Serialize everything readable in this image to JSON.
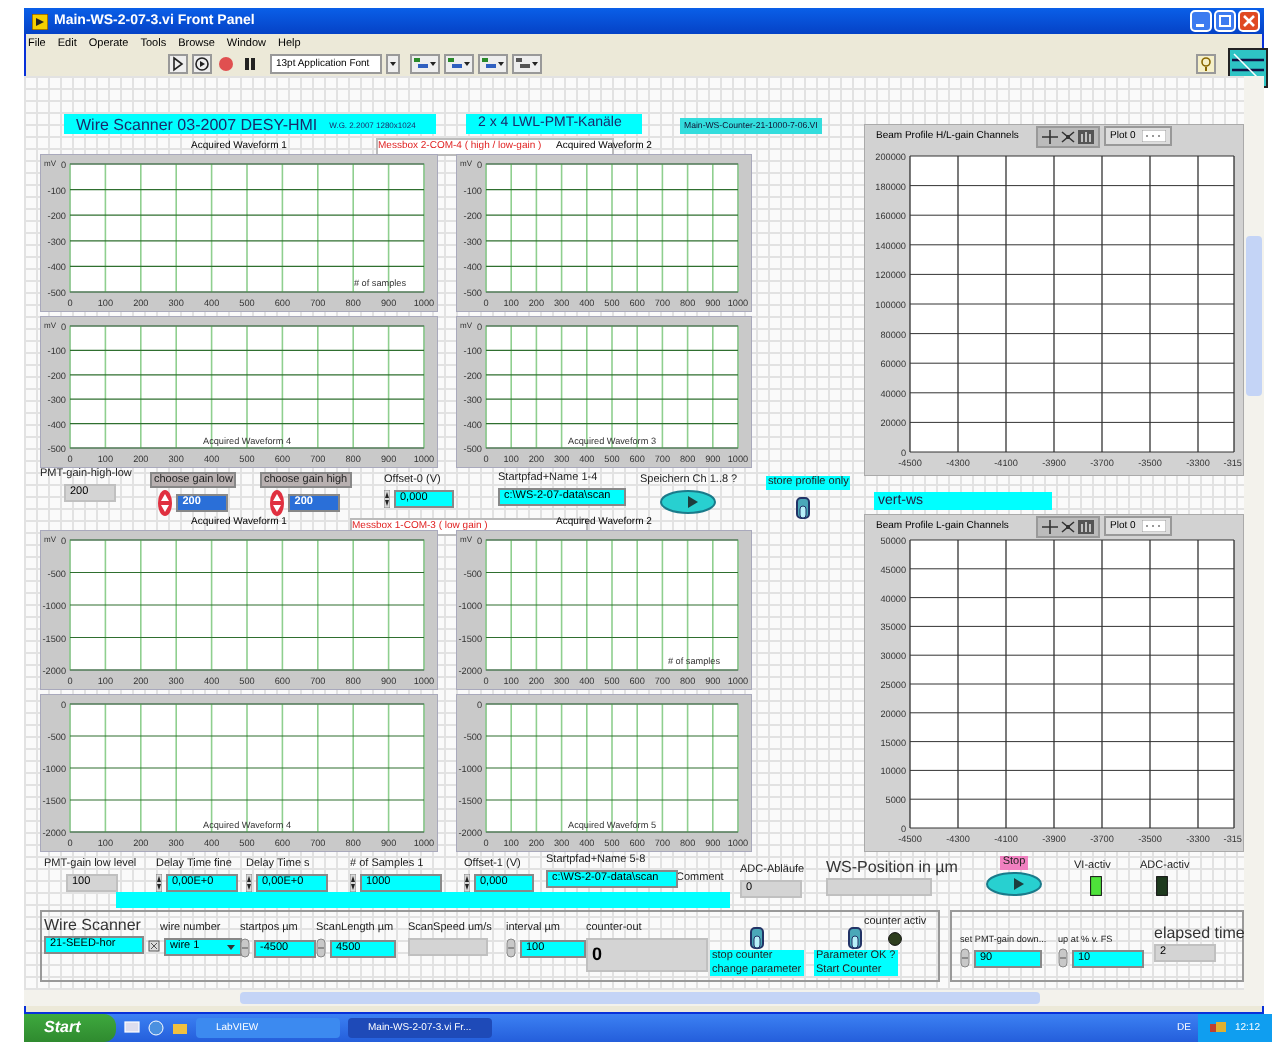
{
  "window": {
    "title": "Main-WS-2-07-3.vi Front Panel"
  },
  "menu": [
    "File",
    "Edit",
    "Operate",
    "Tools",
    "Browse",
    "Window",
    "Help"
  ],
  "toolbar": {
    "font": "13pt Application Font"
  },
  "header": {
    "banner": "Wire Scanner 03-2007   DESY-HMI",
    "banner_note": "W.G. 2.2007   1280x1024",
    "channels_label": "2 x 4  LWL-PMT-Kanäle",
    "vi_name": "Main-WS-Counter-21-1000-7-06.VI"
  },
  "messboxes": [
    "Messbox 2-COM-4   ( high / low-gain )",
    "Messbox 1-COM-3   ( low gain )"
  ],
  "waveform_graphs": [
    {
      "kind": "outer",
      "note": "# of samples",
      "chart_data": {
        "type": "line",
        "grid": true,
        "title": "Acquired Waveform 1",
        "ylabel": "mV",
        "xlim": [
          0,
          1000
        ],
        "ylim": [
          -500,
          0
        ],
        "xticks": [
          0,
          100,
          200,
          300,
          400,
          500,
          600,
          700,
          800,
          900,
          1000
        ],
        "yticks": [
          0,
          -100,
          -200,
          -300,
          -400,
          -500
        ]
      }
    },
    {
      "kind": "outer",
      "chart_data": {
        "type": "line",
        "grid": true,
        "title": "Acquired Waveform 2",
        "ylabel": "mV",
        "xlim": [
          0,
          1000
        ],
        "ylim": [
          -500,
          0
        ],
        "xticks": [
          0,
          100,
          200,
          300,
          400,
          500,
          600,
          700,
          800,
          900,
          1000
        ],
        "yticks": [
          0,
          -100,
          -200,
          -300,
          -400,
          -500
        ]
      }
    },
    {
      "kind": "inner",
      "chart_data": {
        "type": "line",
        "grid": true,
        "title": "Acquired Waveform 4",
        "ylabel": "mV",
        "xlim": [
          0,
          1000
        ],
        "ylim": [
          -500,
          0
        ],
        "xticks": [
          0,
          100,
          200,
          300,
          400,
          500,
          600,
          700,
          800,
          900,
          1000
        ],
        "yticks": [
          0,
          -100,
          -200,
          -300,
          -400,
          -500
        ]
      }
    },
    {
      "kind": "inner",
      "chart_data": {
        "type": "line",
        "grid": true,
        "title": "Acquired Waveform 3",
        "ylabel": "mV",
        "xlim": [
          0,
          1000
        ],
        "ylim": [
          -500,
          0
        ],
        "xticks": [
          0,
          100,
          200,
          300,
          400,
          500,
          600,
          700,
          800,
          900,
          1000
        ],
        "yticks": [
          0,
          -100,
          -200,
          -300,
          -400,
          -500
        ]
      }
    },
    {
      "kind": "outer",
      "chart_data": {
        "type": "line",
        "grid": true,
        "title": "Acquired Waveform 1",
        "ylabel": "mV",
        "xlim": [
          0,
          1000
        ],
        "ylim": [
          -2000,
          0
        ],
        "xticks": [
          0,
          100,
          200,
          300,
          400,
          500,
          600,
          700,
          800,
          900,
          1000
        ],
        "yticks": [
          0,
          -500,
          -1000,
          -1500,
          -2000
        ]
      }
    },
    {
      "kind": "outer",
      "note": "# of samples",
      "chart_data": {
        "type": "line",
        "grid": true,
        "title": "Acquired Waveform 2",
        "ylabel": "mV",
        "xlim": [
          0,
          1000
        ],
        "ylim": [
          -2000,
          0
        ],
        "xticks": [
          0,
          100,
          200,
          300,
          400,
          500,
          600,
          700,
          800,
          900,
          1000
        ],
        "yticks": [
          0,
          -500,
          -1000,
          -1500,
          -2000
        ]
      }
    },
    {
      "kind": "inner",
      "chart_data": {
        "type": "line",
        "grid": true,
        "title": "Acquired Waveform 4",
        "xlim": [
          0,
          1000
        ],
        "ylim": [
          -2000,
          0
        ],
        "xticks": [
          0,
          100,
          200,
          300,
          400,
          500,
          600,
          700,
          800,
          900,
          1000
        ],
        "yticks": [
          0,
          -500,
          -1000,
          -1500,
          -2000
        ]
      }
    },
    {
      "kind": "inner",
      "chart_data": {
        "type": "line",
        "grid": true,
        "title": "Acquired Waveform 5",
        "xlim": [
          0,
          1000
        ],
        "ylim": [
          -2000,
          0
        ],
        "xticks": [
          0,
          100,
          200,
          300,
          400,
          500,
          600,
          700,
          800,
          900,
          1000
        ],
        "yticks": [
          0,
          -500,
          -1000,
          -1500,
          -2000
        ]
      }
    }
  ],
  "profile_graphs": [
    {
      "legend": "Plot 0",
      "edge_label": "-315",
      "chart_data": {
        "type": "line",
        "grid": true,
        "title": "Beam Profile H/L-gain Channels",
        "xlim": [
          -4500,
          -3150
        ],
        "ylim": [
          0,
          200000
        ],
        "xticks": [
          -4500,
          -4300,
          -4100,
          -3900,
          -3700,
          -3500,
          -3300
        ],
        "yticks": [
          0,
          20000,
          40000,
          60000,
          80000,
          100000,
          120000,
          140000,
          160000,
          180000,
          200000
        ]
      }
    },
    {
      "legend": "Plot 0",
      "edge_label": "-315",
      "chart_data": {
        "type": "line",
        "grid": true,
        "title": "Beam Profile L-gain Channels",
        "xlim": [
          -4500,
          -3150
        ],
        "ylim": [
          0,
          50000
        ],
        "xticks": [
          -4500,
          -4300,
          -4100,
          -3900,
          -3700,
          -3500,
          -3300
        ],
        "yticks": [
          0,
          5000,
          10000,
          15000,
          20000,
          25000,
          30000,
          35000,
          40000,
          45000,
          50000
        ]
      }
    }
  ],
  "plot_name": {
    "value": "vert-ws"
  },
  "comment": {
    "label": "Comment"
  },
  "controls": [
    {
      "kind": "indicator",
      "label": "PMT-gain-high-low",
      "value": "200"
    },
    {
      "kind": "numeric",
      "label": "choose gain low",
      "value": "200"
    },
    {
      "kind": "numeric",
      "label": "choose gain high",
      "value": "200"
    },
    {
      "kind": "numeric",
      "label": "Offset-0 (V)",
      "value": "0,000"
    },
    {
      "kind": "string",
      "label": "Startpfad+Name 1-4",
      "value": "c:\\WS-2-07-data\\scan"
    },
    {
      "kind": "button",
      "label": "Speichern Ch 1..8 ?"
    },
    {
      "kind": "toggle",
      "label": "store profile only",
      "on": false
    },
    {
      "kind": "indicator",
      "label": "PMT-gain low level",
      "value": "100"
    },
    {
      "kind": "numeric",
      "label": "Delay Time fine",
      "value": "0,00E+0"
    },
    {
      "kind": "numeric",
      "label": "Delay Time s",
      "value": "0,00E+0"
    },
    {
      "kind": "numeric",
      "label": "# of Samples 1",
      "value": "1000"
    },
    {
      "kind": "numeric",
      "label": "Offset-1 (V)",
      "value": "0,000"
    },
    {
      "kind": "string",
      "label": "Startpfad+Name 5-8",
      "value": "c:\\WS-2-07-data\\scan"
    },
    {
      "kind": "indicator",
      "label": "ADC-Abläufe",
      "value": "0"
    },
    {
      "kind": "indicator",
      "label": "WS-Position in µm"
    },
    {
      "kind": "button",
      "label": "Stop"
    },
    {
      "kind": "led",
      "label": "VI-activ",
      "on": true
    },
    {
      "kind": "led",
      "label": "ADC-activ",
      "on": false
    },
    {
      "kind": "string",
      "label": "Wire Scanner",
      "value": "21-SEED-hor"
    },
    {
      "kind": "ring",
      "label": "wire number",
      "value": "wire 1"
    },
    {
      "kind": "numeric",
      "label": "startpos µm",
      "value": "-4500"
    },
    {
      "kind": "numeric",
      "label": "ScanLength µm",
      "value": "4500"
    },
    {
      "kind": "indicator",
      "label": "ScanSpeed um/s"
    },
    {
      "kind": "numeric",
      "label": "interval µm",
      "value": "100"
    },
    {
      "kind": "indicator",
      "label": "counter-out",
      "value": "0"
    },
    {
      "kind": "toggle",
      "label": "stop counter\nchange parameter",
      "on": false
    },
    {
      "kind": "toggle",
      "label": "Parameter OK ?\nStart Counter",
      "on": false
    },
    {
      "kind": "led",
      "label": "counter activ",
      "on": false
    },
    {
      "kind": "numeric",
      "label": "set PMT-gain down...",
      "value": "90"
    },
    {
      "kind": "numeric",
      "label": "up at % v. FS",
      "value": "10"
    },
    {
      "kind": "indicator",
      "label": "elapsed time",
      "value": "2"
    }
  ],
  "taskbar": {
    "start": "Start",
    "tasks": [
      {
        "label": "LabVIEW",
        "selected": false
      },
      {
        "label": "Main-WS-2-07-3.vi Fr...",
        "selected": true
      }
    ],
    "language": "DE",
    "clock": "12:12"
  }
}
